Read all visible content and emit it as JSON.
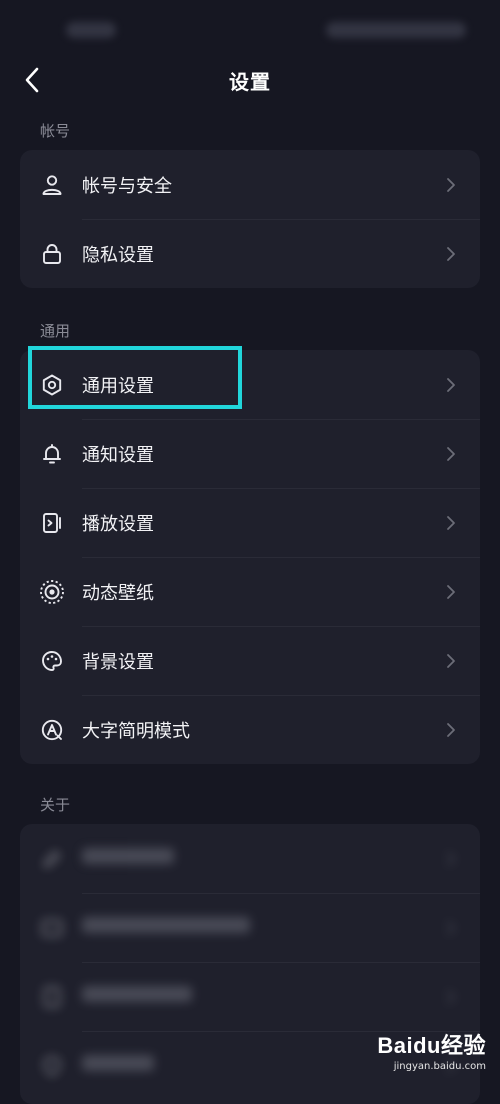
{
  "header": {
    "title": "设置"
  },
  "sections": {
    "account": {
      "label": "帐号",
      "items": [
        {
          "label": "帐号与安全",
          "icon": "user-icon"
        },
        {
          "label": "隐私设置",
          "icon": "lock-icon"
        }
      ]
    },
    "general": {
      "label": "通用",
      "items": [
        {
          "label": "通用设置",
          "icon": "gear-icon"
        },
        {
          "label": "通知设置",
          "icon": "bell-icon"
        },
        {
          "label": "播放设置",
          "icon": "playback-icon"
        },
        {
          "label": "动态壁纸",
          "icon": "live-wallpaper-icon"
        },
        {
          "label": "背景设置",
          "icon": "palette-icon"
        },
        {
          "label": "大字简明模式",
          "icon": "large-font-icon"
        }
      ]
    },
    "about": {
      "label": "关于"
    }
  },
  "watermark": {
    "brand": "Baidu经验",
    "url": "jingyan.baidu.com"
  },
  "colors": {
    "background": "#161722",
    "card": "#1f202c",
    "highlight": "#21d6db",
    "section_label": "#8a8b96"
  }
}
